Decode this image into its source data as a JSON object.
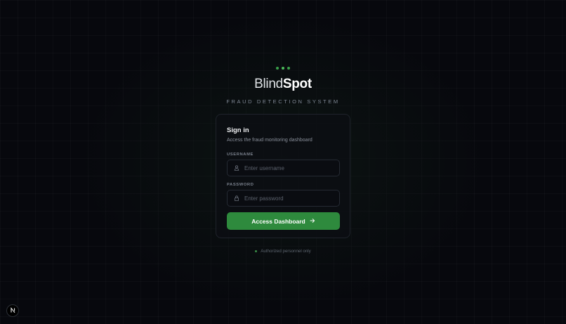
{
  "brand": {
    "name_light": "Blind",
    "name_bold": "Spot",
    "tagline": "FRAUD DETECTION SYSTEM",
    "dot_color": "#3aa04a"
  },
  "login": {
    "title": "Sign in",
    "subtitle": "Access the fraud monitoring dashboard",
    "username": {
      "label": "USERNAME",
      "placeholder": "Enter username",
      "value": "",
      "icon": "user-icon"
    },
    "password": {
      "label": "PASSWORD",
      "placeholder": "Enter password",
      "value": "",
      "icon": "lock-icon"
    },
    "submit_label": "Access Dashboard",
    "submit_icon": "arrow-right-icon",
    "accent_color": "#2e8a3d"
  },
  "footer": {
    "note": "Authorized personnel only"
  },
  "dev_badge": {
    "label": "N",
    "icon": "nextjs-icon"
  }
}
